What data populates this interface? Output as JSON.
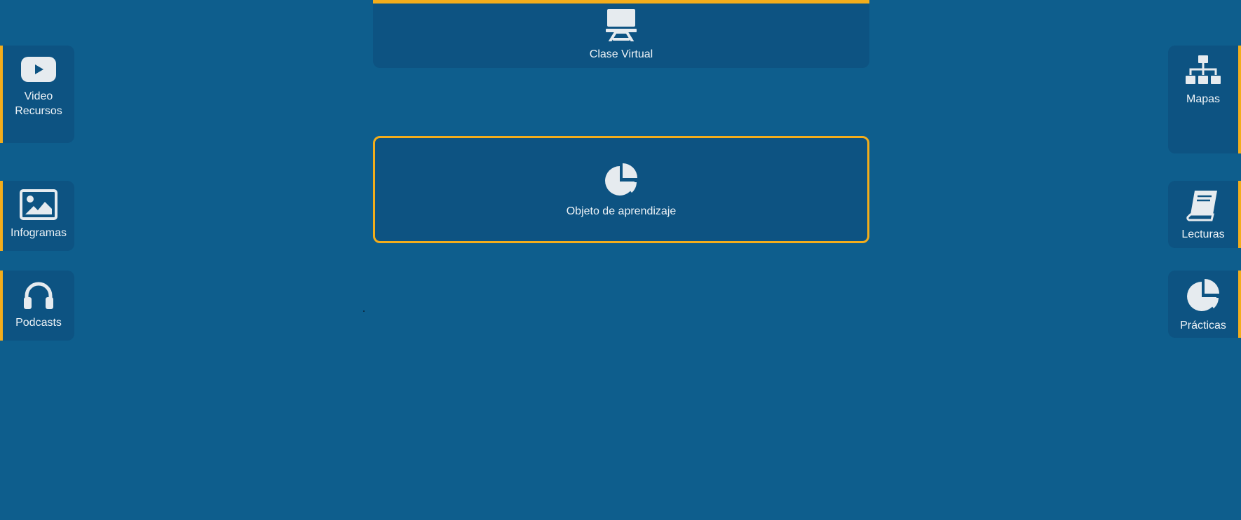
{
  "colors": {
    "background": "#0e5e8d",
    "card": "#0d5382",
    "accent": "#f3ad1b",
    "icon": "#e6ebef",
    "text": "#eef3f7"
  },
  "top": {
    "label": "Clase Virtual",
    "icon": "presentation-board-icon"
  },
  "center": {
    "label": "Objeto de aprendizaje",
    "icon": "pie-chart-icon"
  },
  "left_nav": [
    {
      "label": "Video\nRecursos",
      "icon": "youtube-play-icon"
    },
    {
      "label": "Infogramas",
      "icon": "image-icon"
    },
    {
      "label": "Podcasts",
      "icon": "headphones-icon"
    }
  ],
  "right_nav": [
    {
      "label": "Mapas",
      "icon": "sitemap-icon"
    },
    {
      "label": "Lecturas",
      "icon": "book-icon"
    },
    {
      "label": "Prácticas",
      "icon": "pie-chart-icon"
    }
  ]
}
